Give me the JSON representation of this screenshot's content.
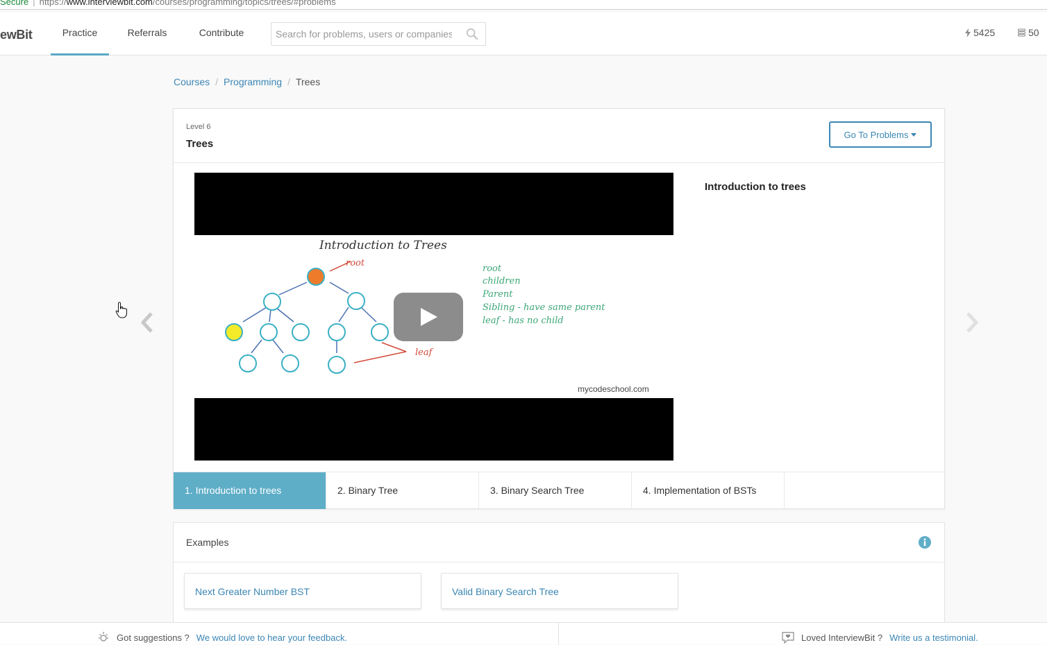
{
  "browser": {
    "secure_label": "Secure",
    "url_prefix": "https://",
    "url_host": "www.interviewbit.com",
    "url_path": "/courses/programming/topics/trees/#problems"
  },
  "navbar": {
    "logo_text": "ewBit",
    "items": [
      {
        "label": "Practice",
        "active": true
      },
      {
        "label": "Referrals",
        "active": false
      },
      {
        "label": "Contribute",
        "active": false
      }
    ],
    "search_placeholder": "Search for problems, users or companies",
    "score": "5425",
    "coins": "50"
  },
  "breadcrumb": {
    "items": [
      "Courses",
      "Programming"
    ],
    "current": "Trees"
  },
  "topic": {
    "level": "Level 6",
    "title": "Trees",
    "goto_label": "Go To Problems",
    "video_title": "Introduction to trees",
    "video_slide": {
      "heading": "Introduction to Trees",
      "terms": [
        "root",
        "children",
        "Parent",
        "Sibling - have same parent",
        "leaf - has no child"
      ],
      "root_label": "root",
      "leaf_label": "leaf",
      "watermark": "mycodeschool.com"
    },
    "tabs": [
      {
        "label": "1. Introduction to trees",
        "active": true
      },
      {
        "label": "2. Binary Tree",
        "active": false
      },
      {
        "label": "3. Binary Search Tree",
        "active": false
      },
      {
        "label": "4. Implementation of BSTs",
        "active": false
      }
    ]
  },
  "examples": {
    "title": "Examples",
    "problems": [
      "Next Greater Number BST",
      "Valid Binary Search Tree"
    ]
  },
  "footer": {
    "suggest_text": "Got suggestions ?",
    "suggest_link": "We would love to hear your feedback.",
    "testimonial_text": "Loved InterviewBit ?",
    "testimonial_link": "Write us a testimonial."
  },
  "colors": {
    "accent": "#3b86b4",
    "active_tab": "#5faec8",
    "tab_underline": "#59a8c5"
  }
}
